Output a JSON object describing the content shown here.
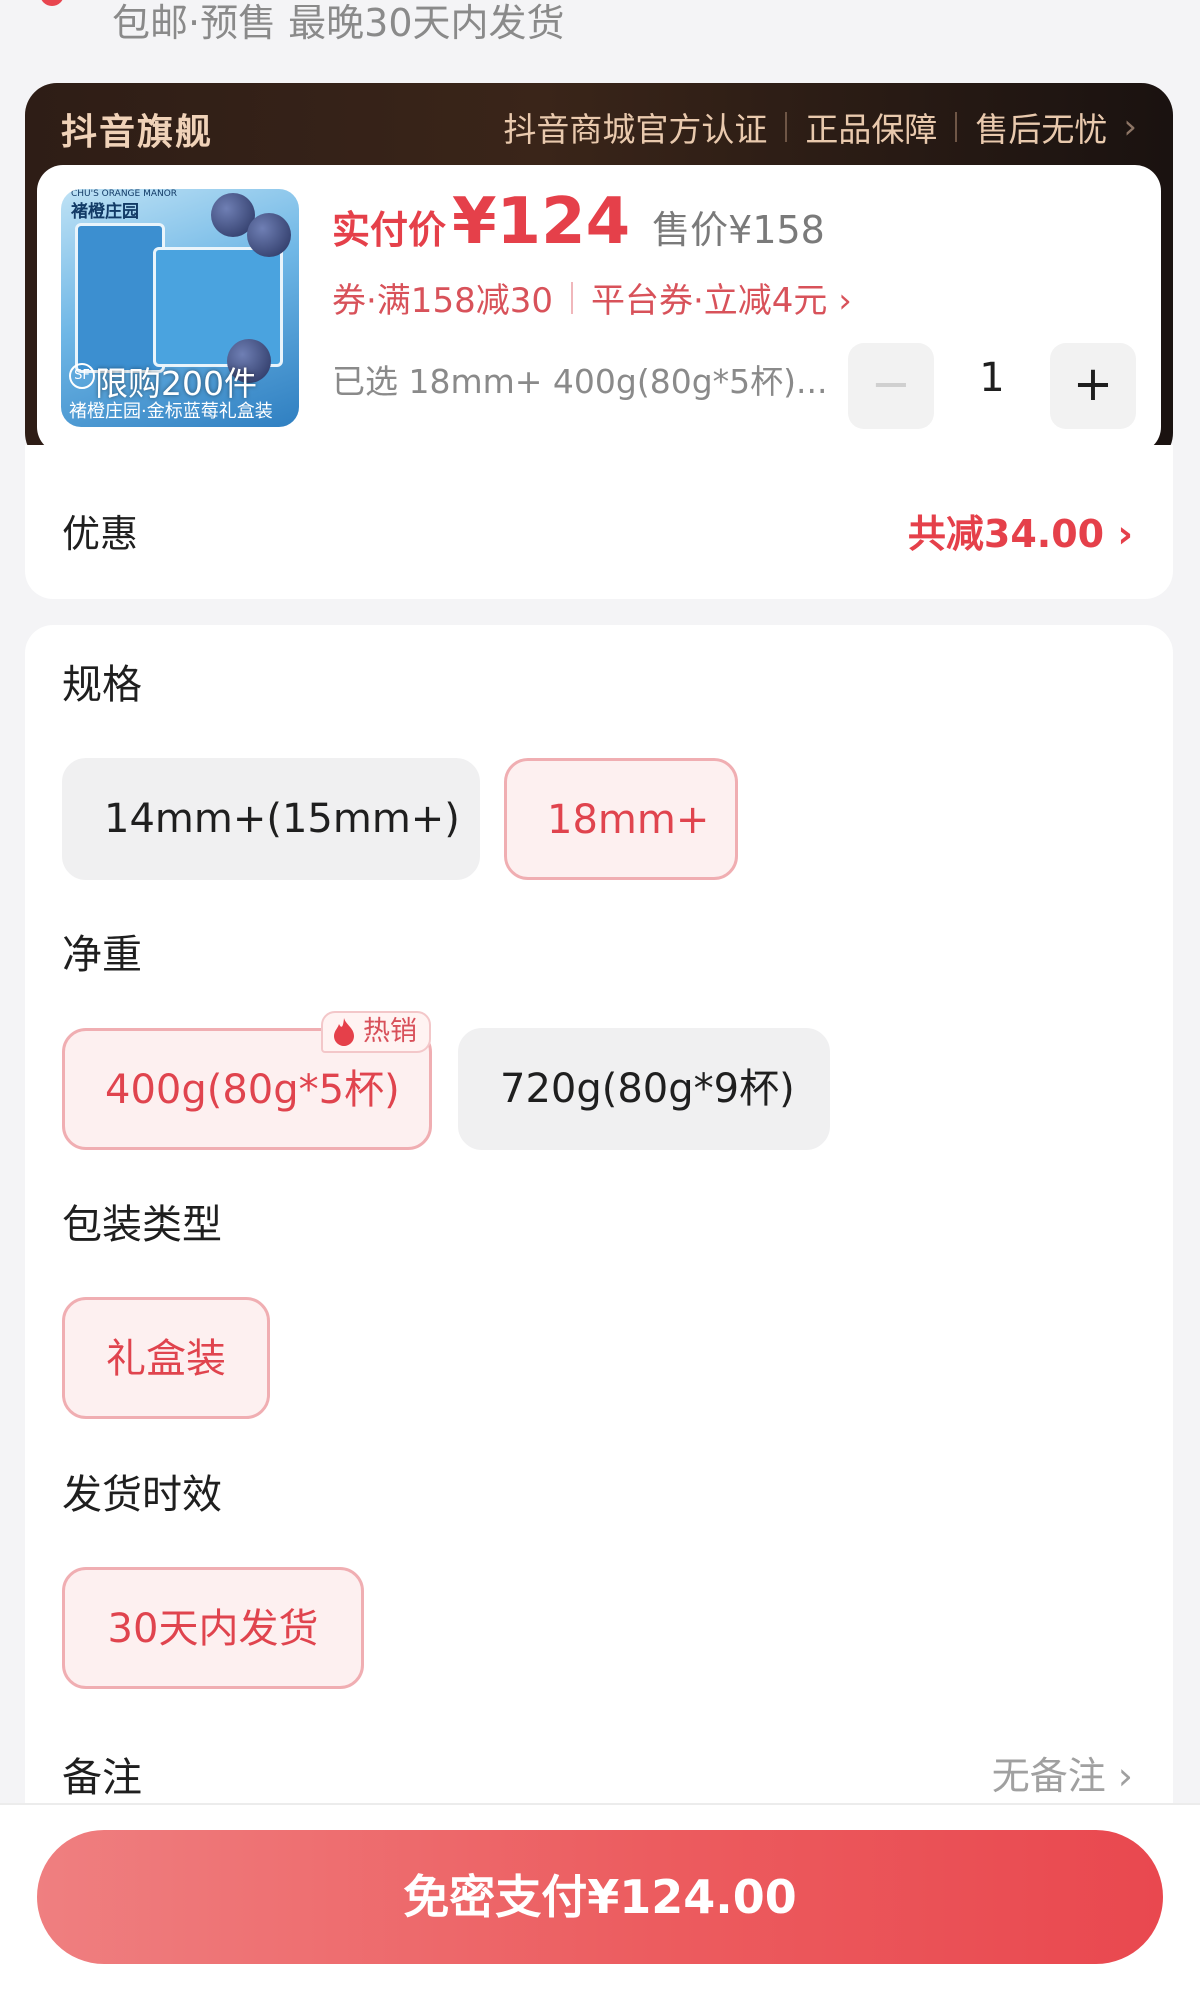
{
  "shipping": {
    "text": "包邮·预售 最晚30天内发货"
  },
  "store": {
    "name": "抖音旗舰",
    "tags": [
      "抖音商城官方认证",
      "正品保障",
      "售后无忧"
    ]
  },
  "product": {
    "thumb": {
      "brand_en": "CHU'S ORANGE MANOR",
      "brand": "褚橙庄园",
      "limit": "限购200件",
      "badge": "SF",
      "caption": "褚橙庄园·金标蓝莓礼盒装"
    },
    "pay_label": "实付价",
    "pay_value": "¥124",
    "orig_price": "售价¥158",
    "coupon": "券·满158减30",
    "platform_coupon": "平台券·立减4元 ›",
    "selected": "已选 18mm+ 400g(80g*5杯)...",
    "quantity": "1",
    "minus": "−",
    "plus": "+"
  },
  "discount": {
    "label": "优惠",
    "value": "共减34.00 ›"
  },
  "options": {
    "spec": {
      "title": "规格",
      "choices": [
        {
          "label": "14mm+(15mm+)",
          "selected": false
        },
        {
          "label": "18mm+",
          "selected": true
        }
      ]
    },
    "weight": {
      "title": "净重",
      "choices": [
        {
          "label": "400g(80g*5杯)",
          "selected": true,
          "badge": "热销"
        },
        {
          "label": "720g(80g*9杯)",
          "selected": false
        }
      ]
    },
    "package": {
      "title": "包装类型",
      "choices": [
        {
          "label": "礼盒装",
          "selected": true
        }
      ]
    },
    "delivery": {
      "title": "发货时效",
      "choices": [
        {
          "label": "30天内发货",
          "selected": true
        }
      ]
    },
    "remark": {
      "label": "备注",
      "value": "无备注 ›"
    }
  },
  "pay_button": {
    "label": "免密支付¥124.00"
  },
  "colors": {
    "accent": "#e5404a",
    "card_dark": "#2e1d16",
    "chip_selected_bg": "#fdf0f0"
  },
  "icons": {
    "store_chevron": "chevron-right-icon",
    "hot": "flame-icon"
  }
}
